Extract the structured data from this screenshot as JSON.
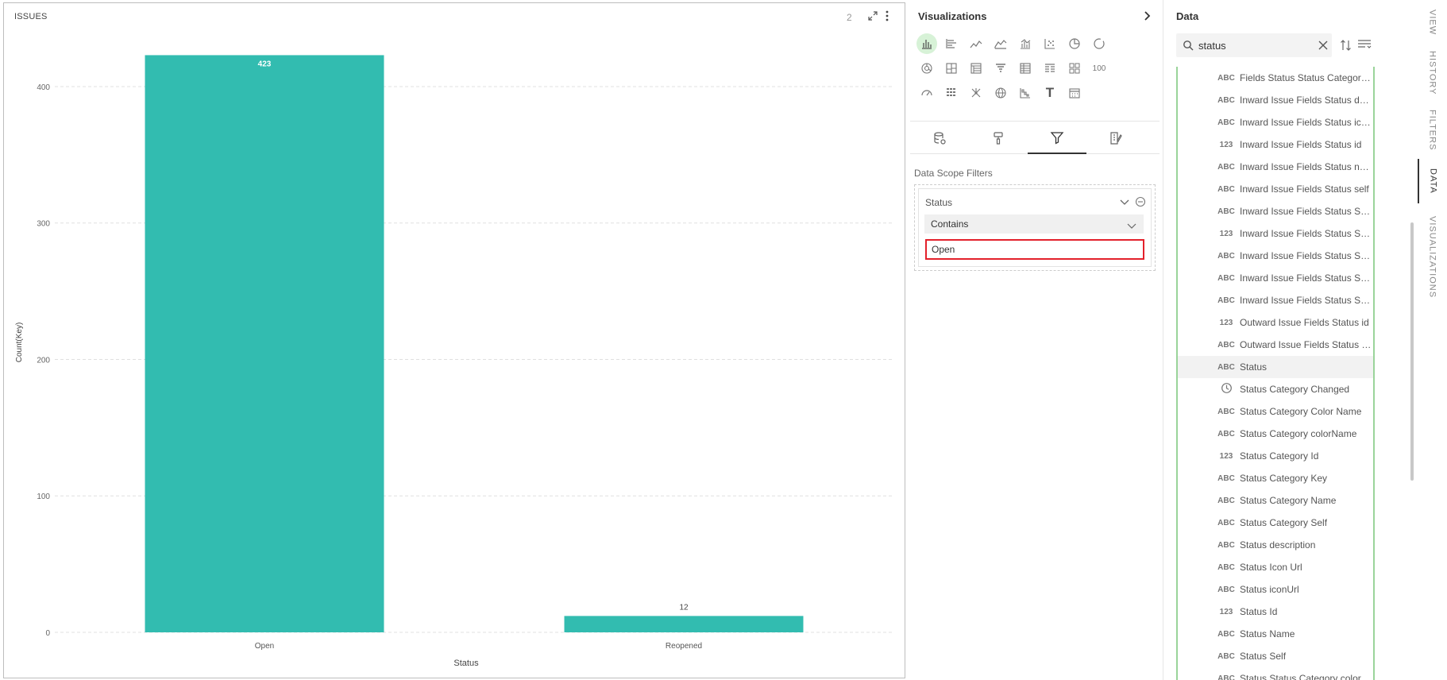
{
  "chart_panel": {
    "title": "ISSUES",
    "count_badge": "2",
    "expand_icon": "expand-icon",
    "more_icon": "more-vertical-icon"
  },
  "chart_data": {
    "type": "bar",
    "categories": [
      "Open",
      "Reopened"
    ],
    "values": [
      423,
      12
    ],
    "data_labels": [
      "423",
      "12"
    ],
    "xlabel": "Status",
    "ylabel": "Count(Key)",
    "ylim": [
      0,
      425
    ],
    "yticks": [
      0,
      100,
      200,
      300,
      400
    ],
    "ytick_labels": [
      "0",
      "100",
      "200",
      "300",
      "400"
    ],
    "grid": true,
    "bar_color": "#32bcb0",
    "grid_color": "#e0e0e0"
  },
  "visualizations": {
    "title": "Visualizations",
    "collapse_icon": "chevron-right-icon",
    "icons": [
      "bar-chart-icon",
      "horizontal-bar-icon",
      "line-chart-icon",
      "area-chart-icon",
      "combo-chart-icon",
      "scatter-icon",
      "pie-icon",
      "donut-icon",
      "sunburst-icon",
      "treemap-icon",
      "pivot-icon",
      "funnel-icon",
      "table-icon",
      "detail-table-icon",
      "grid-icon",
      "kpi-icon",
      "gauge-icon",
      "heatmap-icon",
      "network-icon",
      "globe-icon",
      "waterfall-icon",
      "text-icon",
      "calendar-icon"
    ],
    "kpi_label": "100",
    "text_label": "T",
    "tabs": [
      "data-source-icon",
      "format-brush-icon",
      "filter-icon",
      "analytics-icon"
    ],
    "active_tab": 2,
    "data_scope_label": "Data Scope Filters",
    "filter": {
      "field": "Status",
      "operator": "Contains",
      "value": "Open"
    }
  },
  "data_panel": {
    "title": "Data",
    "search_value": "status",
    "fields": [
      {
        "type": "ABC",
        "label": "Fields Status Status Category Changed"
      },
      {
        "type": "ABC",
        "label": "Inward Issue Fields Status description"
      },
      {
        "type": "ABC",
        "label": "Inward Issue Fields Status iconUrl"
      },
      {
        "type": "123",
        "label": "Inward Issue Fields Status id"
      },
      {
        "type": "ABC",
        "label": "Inward Issue Fields Status name"
      },
      {
        "type": "ABC",
        "label": "Inward Issue Fields Status self"
      },
      {
        "type": "ABC",
        "label": "Inward Issue Fields Status Status Category colorName"
      },
      {
        "type": "123",
        "label": "Inward Issue Fields Status Status Category id"
      },
      {
        "type": "ABC",
        "label": "Inward Issue Fields Status Status Category key"
      },
      {
        "type": "ABC",
        "label": "Inward Issue Fields Status Status Category name"
      },
      {
        "type": "ABC",
        "label": "Inward Issue Fields Status Status Category self"
      },
      {
        "type": "123",
        "label": "Outward Issue Fields Status id"
      },
      {
        "type": "ABC",
        "label": "Outward Issue Fields Status name"
      },
      {
        "type": "ABC",
        "label": "Status"
      },
      {
        "type": "clock",
        "label": "Status Category Changed"
      },
      {
        "type": "ABC",
        "label": "Status Category Color Name"
      },
      {
        "type": "ABC",
        "label": "Status Category colorName"
      },
      {
        "type": "123",
        "label": "Status Category Id"
      },
      {
        "type": "ABC",
        "label": "Status Category Key"
      },
      {
        "type": "ABC",
        "label": "Status Category Name"
      },
      {
        "type": "ABC",
        "label": "Status Category Self"
      },
      {
        "type": "ABC",
        "label": "Status description"
      },
      {
        "type": "ABC",
        "label": "Status Icon Url"
      },
      {
        "type": "ABC",
        "label": "Status iconUrl"
      },
      {
        "type": "123",
        "label": "Status Id"
      },
      {
        "type": "ABC",
        "label": "Status Name"
      },
      {
        "type": "ABC",
        "label": "Status Self"
      },
      {
        "type": "ABC",
        "label": "Status Status Category color"
      }
    ],
    "selected_index": 13
  },
  "side_tabs": [
    {
      "label": "VIEW"
    },
    {
      "label": "HISTORY"
    },
    {
      "label": "FILTERS"
    },
    {
      "label": "DATA"
    },
    {
      "label": "VISUALIZATIONS"
    }
  ],
  "side_tabs_active": [
    3
  ]
}
